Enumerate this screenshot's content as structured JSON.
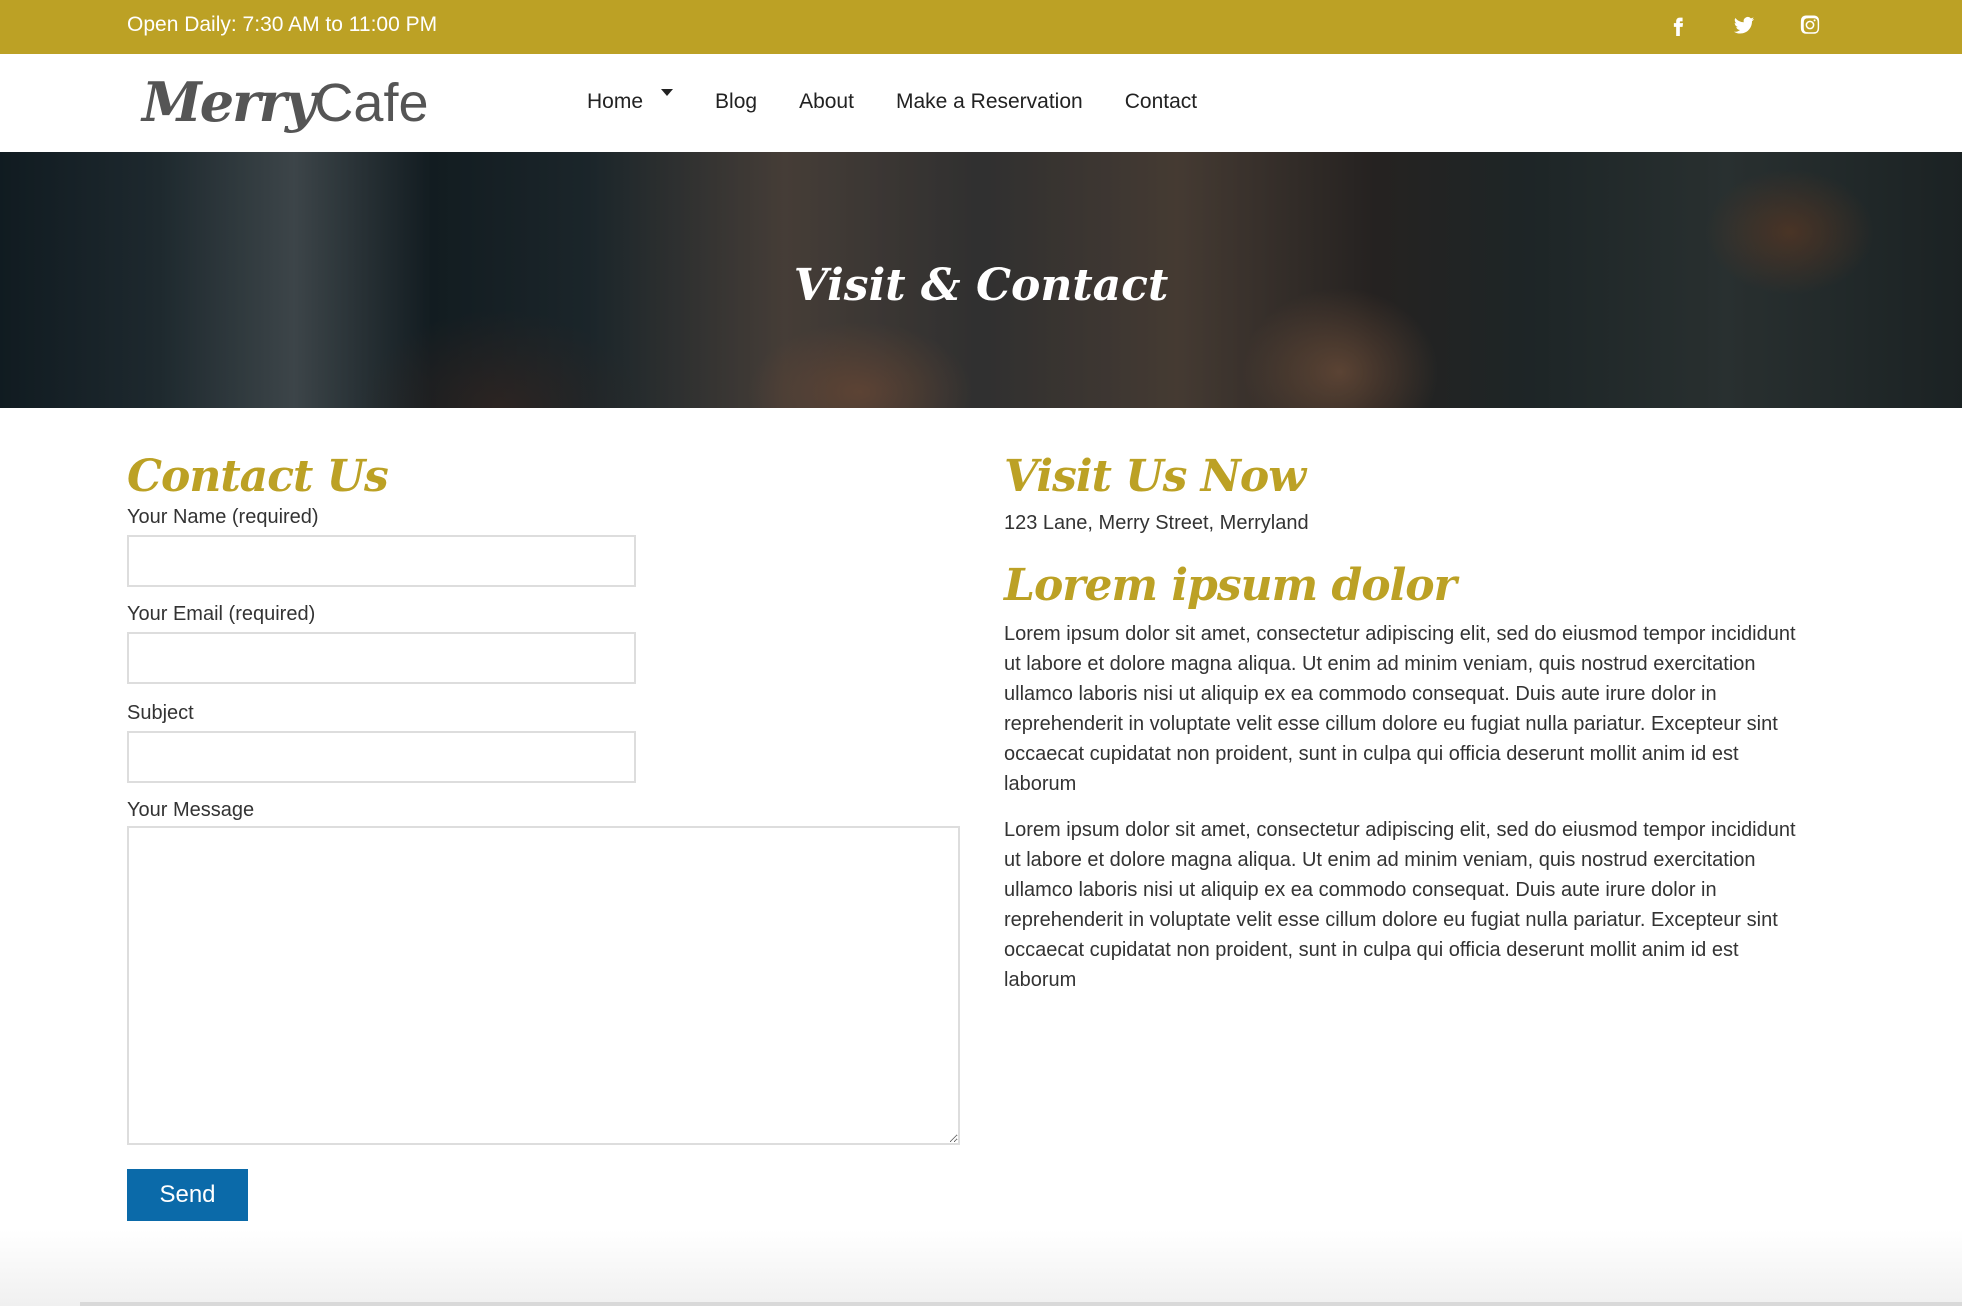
{
  "topbar": {
    "hours": "Open Daily: 7:30 AM to 11:00 PM",
    "social": [
      "facebook-icon",
      "twitter-icon",
      "instagram-icon"
    ]
  },
  "header": {
    "logo_part1": "Merry",
    "logo_part2": "Cafe",
    "nav": {
      "home": "Home",
      "blog": "Blog",
      "about": "About",
      "reservation": "Make a Reservation",
      "contact": "Contact"
    }
  },
  "hero": {
    "title": "Visit & Contact"
  },
  "contact_form": {
    "heading": "Contact Us",
    "name_label": "Your Name (required)",
    "name_value": "",
    "email_label": "Your Email (required)",
    "email_value": "",
    "subject_label": "Subject",
    "subject_value": "",
    "message_label": "Your Message",
    "message_value": "",
    "send_label": "Send"
  },
  "visit": {
    "heading": "Visit Us Now",
    "address": "123 Lane, Merry Street, Merryland",
    "lorem_heading": "Lorem ipsum dolor",
    "paragraphs": [
      "Lorem ipsum dolor sit amet, consectetur adipiscing elit, sed do eiusmod tempor incididunt ut labore et dolore magna aliqua. Ut enim ad minim veniam, quis nostrud exercitation ullamco laboris nisi ut aliquip ex ea commodo consequat. Duis aute irure dolor in reprehenderit in voluptate velit esse cillum dolore eu fugiat nulla pariatur. Excepteur sint occaecat cupidatat non proident, sunt in culpa qui officia deserunt mollit anim id est laborum",
      "Lorem ipsum dolor sit amet, consectetur adipiscing elit, sed do eiusmod tempor incididunt ut labore et dolore magna aliqua. Ut enim ad minim veniam, quis nostrud exercitation ullamco laboris nisi ut aliquip ex ea commodo consequat. Duis aute irure dolor in reprehenderit in voluptate velit esse cillum dolore eu fugiat nulla pariatur. Excepteur sint occaecat cupidatat non proident, sunt in culpa qui officia deserunt mollit anim id est laborum"
    ]
  },
  "colors": {
    "accent": "#bca125",
    "button": "#0b6aa9"
  }
}
